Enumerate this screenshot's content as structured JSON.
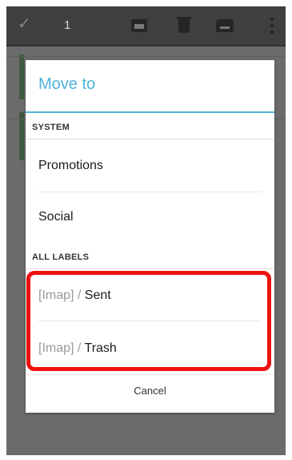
{
  "action_bar": {
    "selected_count": "1",
    "icons": [
      "check-icon",
      "archive-icon",
      "trash-icon",
      "move-to-icon",
      "overflow-menu-icon"
    ]
  },
  "dialog": {
    "title": "Move to",
    "sections": [
      {
        "header": "SYSTEM",
        "items": [
          {
            "label": "Promotions"
          },
          {
            "label": "Social"
          }
        ]
      },
      {
        "header": "ALL LABELS",
        "items": [
          {
            "prefix": "[Imap] / ",
            "label": "Sent"
          },
          {
            "prefix": "[Imap] / ",
            "label": "Trash"
          }
        ]
      }
    ],
    "cancel_label": "Cancel"
  },
  "colors": {
    "title": "#4fb3d9",
    "highlight": "#ee1111",
    "action_bar": "#3f3f3f"
  }
}
